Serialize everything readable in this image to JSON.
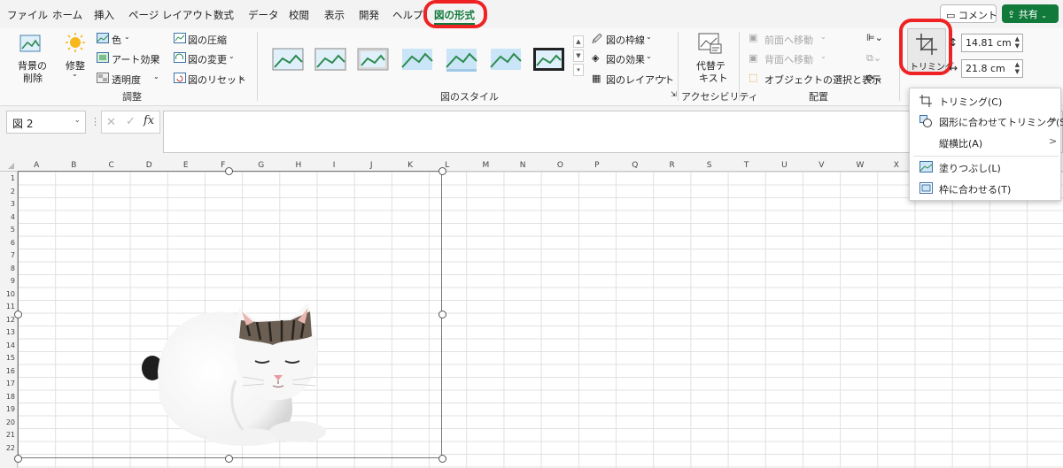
{
  "menu": {
    "tabs": [
      "ファイル",
      "ホーム",
      "挿入",
      "ページ レイアウト",
      "数式",
      "データ",
      "校閲",
      "表示",
      "開発",
      "ヘルプ",
      "図の形式"
    ],
    "comment": "コメント",
    "share": "共有"
  },
  "ribbon": {
    "remove_bg_line1": "背景の",
    "remove_bg_line2": "削除",
    "correct": "修整",
    "color": "色",
    "art_effect": "アート効果",
    "transparency": "透明度",
    "compress": "図の圧縮",
    "change": "図の変更",
    "reset": "図のリセット",
    "group_adjust": "調整",
    "group_styles": "図のスタイル",
    "border": "図の枠線",
    "effects": "図の効果",
    "layout": "図のレイアウト",
    "alt_text_line1": "代替テ",
    "alt_text_line2": "キスト",
    "group_access": "アクセシビリティ",
    "bring_forward": "前面へ移動",
    "send_backward": "背面へ移動",
    "selection_pane": "オブジェクトの選択と表示",
    "group_arrange": "配置",
    "crop": "トリミング",
    "height": "14.81 cm",
    "width": "21.8 cm"
  },
  "formula": {
    "name_box": "図 2",
    "fx": "fx"
  },
  "grid": {
    "columns": [
      "A",
      "B",
      "C",
      "D",
      "E",
      "F",
      "G",
      "H",
      "I",
      "J",
      "K",
      "L",
      "M",
      "N",
      "O",
      "P",
      "Q",
      "R",
      "S",
      "T",
      "U",
      "V",
      "W",
      "X"
    ],
    "rows": [
      "1",
      "2",
      "3",
      "4",
      "5",
      "6",
      "7",
      "8",
      "9",
      "10",
      "11",
      "12",
      "13",
      "14",
      "15",
      "16",
      "17",
      "18",
      "19",
      "20",
      "21",
      "22"
    ]
  },
  "crop_menu": {
    "items": [
      "トリミング(C)",
      "図形に合わせてトリミング(S)",
      "縦横比(A)",
      "塗りつぶし(L)",
      "枠に合わせる(T)"
    ]
  },
  "colors": {
    "accent": "#117a3b",
    "highlight": "#ee2222"
  }
}
